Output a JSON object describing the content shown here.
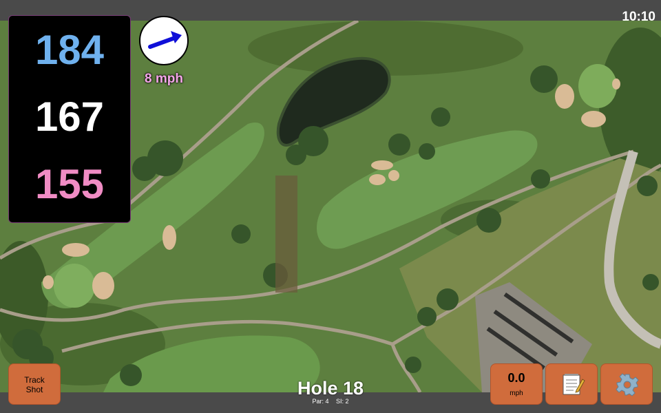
{
  "clock": "10:10",
  "distances": {
    "back": "184",
    "middle": "167",
    "front": "155"
  },
  "wind": {
    "speed_label": "8 mph",
    "icon": "arrow-right-icon"
  },
  "buttons": {
    "track_shot": "Track\nShot",
    "wind_value": "0.0",
    "wind_unit": "mph",
    "notes_icon": "notepad-icon",
    "settings_icon": "gear-icon"
  },
  "hole": {
    "title": "Hole 18",
    "par": "Par: 4",
    "si": "SI: 2"
  },
  "colors": {
    "back": "#6fb1ee",
    "middle": "#ffffff",
    "front": "#f08cc4",
    "wind_speed": "#f4a6e8",
    "button": "#d06c3c"
  }
}
